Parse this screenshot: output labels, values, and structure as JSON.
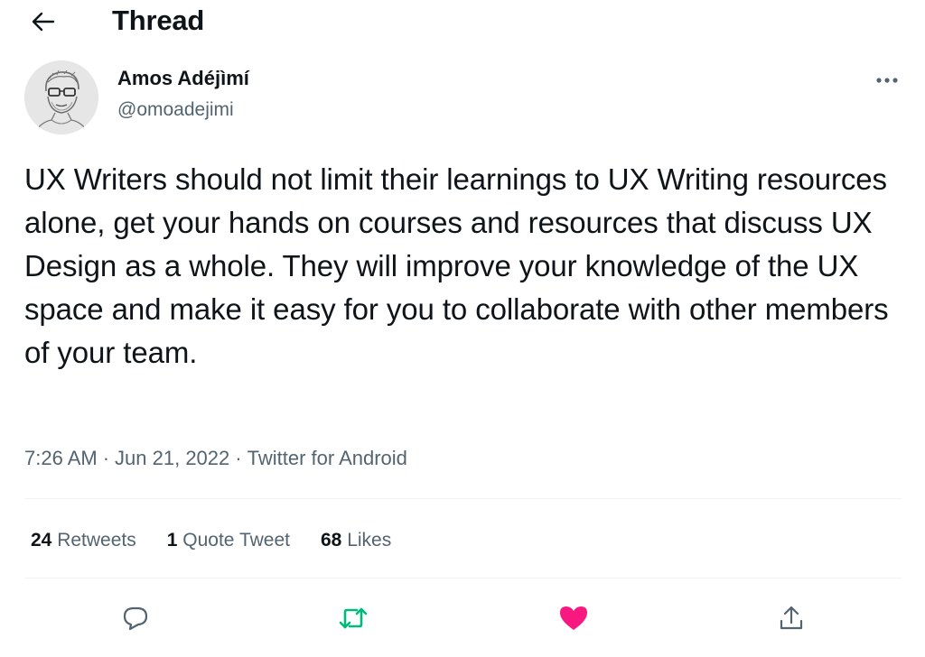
{
  "header": {
    "title": "Thread",
    "back_icon": "arrow-left-icon"
  },
  "author": {
    "name": "Amos Adéjìmí",
    "handle": "@omoadejimi",
    "more_icon": "more-horizontal-icon"
  },
  "tweet": {
    "text": "UX Writers should not limit their learnings to UX Writing resources alone, get your hands on courses and resources that discuss UX Design as a whole. They will improve your knowledge of the UX space and make it easy for you to collaborate with other members of your team.",
    "time": "7:26 AM",
    "date": "Jun 21, 2022",
    "source": "Twitter for Android",
    "separator": "·"
  },
  "stats": {
    "retweets_count": "24",
    "retweets_label": "Retweets",
    "quotes_count": "1",
    "quotes_label": "Quote Tweet",
    "likes_count": "68",
    "likes_label": "Likes"
  },
  "actions": {
    "reply_icon": "reply-icon",
    "retweet_icon": "retweet-icon",
    "like_icon": "heart-filled-icon",
    "share_icon": "share-icon"
  },
  "colors": {
    "text_primary": "#0f1419",
    "text_secondary": "#536471",
    "retweet_active": "#00ba7c",
    "like_active": "#f91880",
    "divider": "#eff3f4"
  }
}
